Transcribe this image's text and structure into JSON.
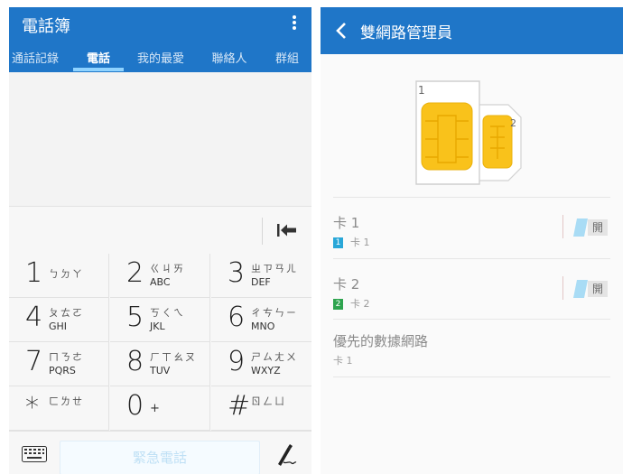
{
  "phonebook": {
    "title": "電話簿",
    "tabs": [
      {
        "label": "通話記錄"
      },
      {
        "label": "電話",
        "active": true
      },
      {
        "label": "我的最愛"
      },
      {
        "label": "聯絡人"
      },
      {
        "label": "群組"
      }
    ],
    "keys": [
      {
        "digit": "1",
        "zhuyin": "ㄅㄉㄚ",
        "latin": ""
      },
      {
        "digit": "2",
        "zhuyin": "ㄍㄐㄞ",
        "latin": "ABC"
      },
      {
        "digit": "3",
        "zhuyin": "ㄓㄗㄢㄦ",
        "latin": "DEF"
      },
      {
        "digit": "4",
        "zhuyin": "ㄆㄊㄛ",
        "latin": "GHI"
      },
      {
        "digit": "5",
        "zhuyin": "ㄎㄑㄟ",
        "latin": "JKL"
      },
      {
        "digit": "6",
        "zhuyin": "ㄔㄘㄣㄧ",
        "latin": "MNO"
      },
      {
        "digit": "7",
        "zhuyin": "ㄇㄋㄜ",
        "latin": "PQRS"
      },
      {
        "digit": "8",
        "zhuyin": "ㄏㄒㄠㄡ",
        "latin": "TUV"
      },
      {
        "digit": "9",
        "zhuyin": "ㄕㄙㄤㄨ",
        "latin": "WXYZ"
      },
      {
        "digit": "*",
        "zhuyin": "ㄈㄌㄝ",
        "latin": ""
      },
      {
        "digit": "0",
        "zhuyin": "",
        "latin": "",
        "extra": "+"
      },
      {
        "digit": "#",
        "zhuyin": "ㄖㄥㄩ",
        "latin": ""
      }
    ],
    "emergency_label": "緊急電話"
  },
  "dual_sim": {
    "title": "雙網路管理員",
    "illustration": {
      "sim1_number": "1",
      "sim2_number": "2"
    },
    "sims": [
      {
        "name": "卡 1",
        "badge": "1",
        "sub": "卡 1",
        "badge_color": "#29a7d8",
        "toggle_label": "開"
      },
      {
        "name": "卡 2",
        "badge": "2",
        "sub": "卡 2",
        "badge_color": "#2ea44f",
        "toggle_label": "開"
      }
    ],
    "preferred_network": {
      "title": "優先的數據網路",
      "value": "卡 1"
    }
  },
  "colors": {
    "header_blue": "#1f76c8",
    "sim_chip": "#f9c21b"
  }
}
